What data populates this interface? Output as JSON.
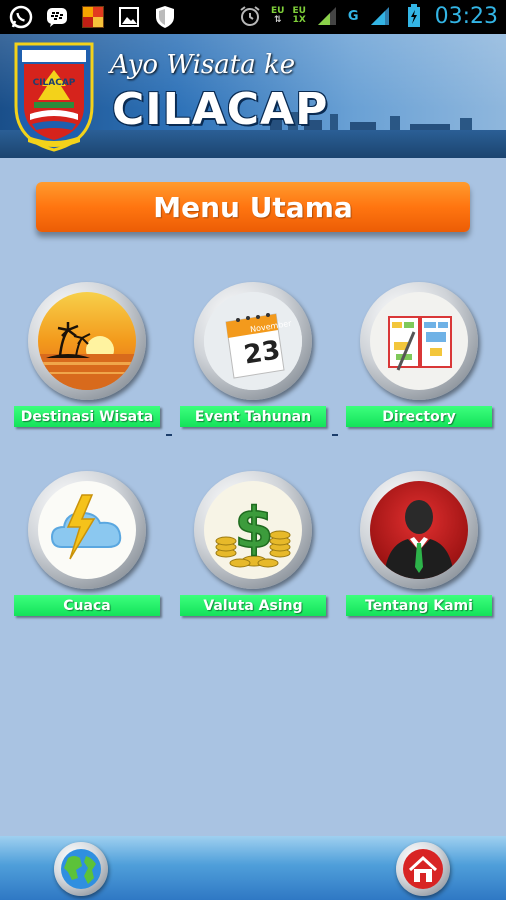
{
  "status_bar": {
    "network_1": "EU",
    "network_2_top": "EU",
    "network_2_bottom": "1X",
    "network_type": "G",
    "time": "03:23",
    "icons": [
      "whatsapp-icon",
      "bbm-icon",
      "app-icon",
      "image-icon",
      "shield-icon",
      "alarm-icon",
      "signal-icon",
      "battery-icon"
    ]
  },
  "header": {
    "subtitle": "Ayo Wisata ke",
    "title": "CILACAP",
    "crest_text": "CILACAP"
  },
  "menu": {
    "title": "Menu Utama"
  },
  "tiles": [
    {
      "label": "Destinasi Wisata",
      "icon": "sunset-beach-icon"
    },
    {
      "label": "Event Tahunan",
      "icon": "calendar-icon"
    },
    {
      "label": "Directory",
      "icon": "directory-book-icon"
    },
    {
      "label": "Cuaca",
      "icon": "weather-icon"
    },
    {
      "label": "Valuta Asing",
      "icon": "money-icon"
    },
    {
      "label": "Tentang Kami",
      "icon": "person-icon"
    }
  ],
  "calendar": {
    "month": "November",
    "day": "23"
  },
  "bottom_bar": {
    "left_icon": "globe-icon",
    "right_icon": "home-icon"
  },
  "colors": {
    "background": "#a9c3e2",
    "menu_orange": "#ff7510",
    "label_green": "#14e25a",
    "status_blue": "#33b5e5"
  }
}
